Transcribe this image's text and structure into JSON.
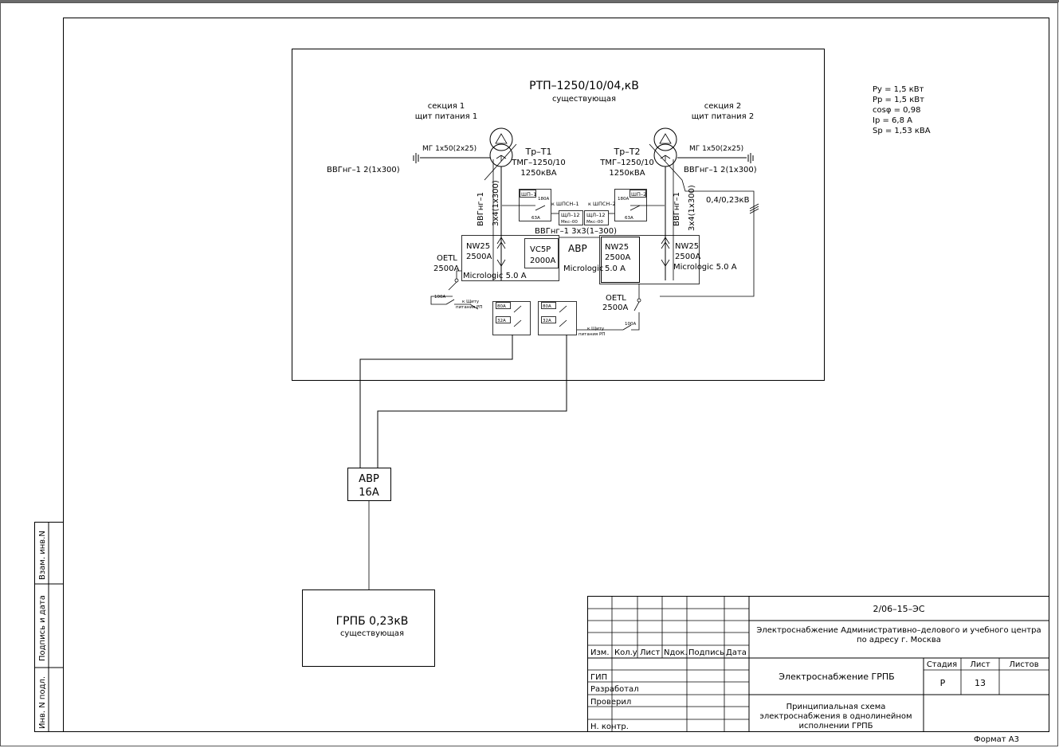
{
  "substation": {
    "title": "РТП–1250/10/04,кВ",
    "status": "существующая"
  },
  "sections": {
    "s1_title": "секция 1",
    "s1_sub": "щит питания 1",
    "s2_title": "секция 2",
    "s2_sub": "щит питания 2"
  },
  "transformers": {
    "t1": {
      "name": "Тр–Т1",
      "model": "ТМГ–1250/10",
      "power": "1250кВА"
    },
    "t2": {
      "name": "Тр–Т2",
      "model": "ТМГ–1250/10",
      "power": "1250кВА"
    }
  },
  "ground": {
    "label1": "МГ 1х50(2х25)",
    "label2": "МГ 1х50(2х25)"
  },
  "cables": {
    "left_horizontal": "ВВГнг–1 2(1х300)",
    "right_horizontal": "ВВГнг–1 2(1х300)",
    "left_vert_a": "ВВГнг–1",
    "left_vert_b": "3х4(1х300)",
    "right_vert_a": "ВВГнг–1",
    "right_vert_b": "3х4(1х300)",
    "middle": "ВВГнг–1 3х3(1–300)",
    "voltage": "0,4/0,23кВ"
  },
  "aux_panels": {
    "shp1": "ШП–1",
    "shp2": "ШП–2",
    "a180_1": "180А",
    "a63_1": "63А",
    "a180_2": "180А",
    "a63_2": "63А",
    "to1": "к ШПСН–1",
    "to2": "к ШПСН–2",
    "shl12a": "ЩЛ–12",
    "shl12b": "ЩЛ–12",
    "mkc1": "Мкс–00",
    "mkc2": "Мкс–00"
  },
  "breakers": {
    "nw_left": {
      "type": "NW25",
      "rating": "2500А",
      "unit": "Micrologic 5.0 A"
    },
    "nw_mid": {
      "type": "NW25",
      "rating": "2500А",
      "unit_a": "Micrologic",
      "unit_b": "5.0 A"
    },
    "nw_right": {
      "type": "NW25",
      "rating": "2500А",
      "unit": "Micrologic 5.0 A"
    },
    "vc5p": {
      "type": "VC5P",
      "rating": "2000А"
    },
    "avr_label": "АВР",
    "oetl_left": {
      "type": "OETL",
      "rating": "2500А"
    },
    "oetl_right": {
      "type": "OETL",
      "rating": "2500А"
    },
    "a100_left": "100А",
    "a100_right": "100А",
    "shield_left_a": "к Щиту",
    "shield_left_b": "питания РП",
    "shield_right_a": "к Щиту",
    "shield_right_b": "питания РП",
    "fuse_1a": "80А",
    "fuse_1b": "32А",
    "fuse_2a": "80А",
    "fuse_2b": "32А"
  },
  "avr16": {
    "label": "АВР",
    "rating": "16А"
  },
  "grpb": {
    "label": "ГРПБ 0,23кВ",
    "status": "существующая"
  },
  "load_params": [
    "Ру = 1,5 кВт",
    "Рр = 1,5 кВт",
    "cosφ = 0,98",
    "Iр = 6,8 А",
    "Sр = 1,53 кВА"
  ],
  "side_stamp": {
    "c1": "Взам. инв.N",
    "c2": "Подпись и дата",
    "c3": "Инв. N подл."
  },
  "title_block": {
    "doc_code": "2/06–15–ЭС",
    "project": "Электроснабжение Административно–делового и учебного центра по адресу г. Москва",
    "section": "Электроснабжение ГРПБ",
    "drawing": "Принципиальная схема электроснабжения в однолинейном исполнении ГРПБ",
    "headers": [
      "Изм.",
      "Кол.у",
      "Лист",
      "Nдок.",
      "Подпись",
      "Дата"
    ],
    "roles": [
      "ГИП",
      "Разработал",
      "Проверил",
      "",
      "Н. контр."
    ],
    "stage_label": "Стадия",
    "sheet_label": "Лист",
    "sheets_label": "Листов",
    "stage": "Р",
    "sheet": "13",
    "sheets": "",
    "format": "Формат А3"
  }
}
